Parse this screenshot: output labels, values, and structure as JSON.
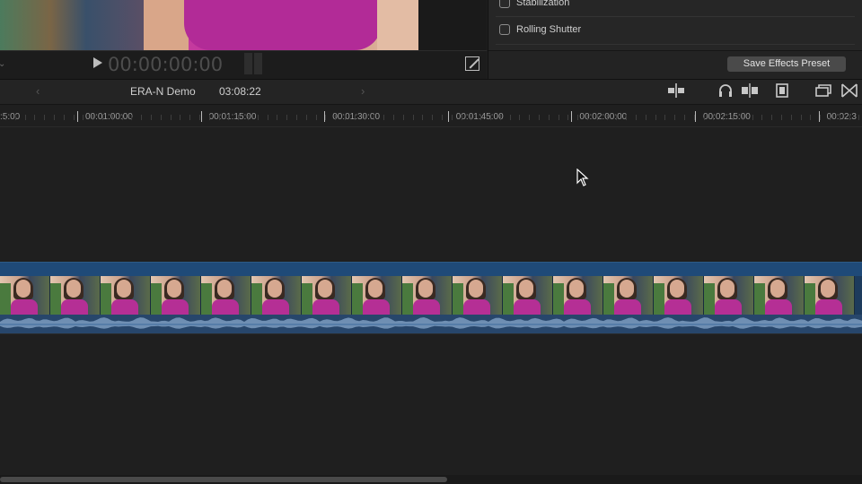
{
  "viewer": {
    "timecode": "00:00:00:00"
  },
  "inspector": {
    "options": [
      {
        "label": "Stabilization",
        "checked": false
      },
      {
        "label": "Rolling Shutter",
        "checked": false
      }
    ],
    "save_button": "Save Effects Preset"
  },
  "timeline": {
    "project_name": "ERA-N Demo",
    "project_duration": "03:08:22",
    "ruler": [
      ":5:00",
      "00:01:00:00",
      "00:01:15:00",
      "00:01:30:00",
      "00:01:45:00",
      "00:02:00:00",
      "00:02:15:00",
      "00:02:3"
    ],
    "clip_frames": 17
  },
  "icons": {
    "play": "play-icon",
    "fullscreen": "fullscreen-icon",
    "header_right": [
      "clip-appearance-icon",
      "audio-skimming-icon",
      "snapping-icon",
      "clip-connections-icon",
      "browser-toggle-icon",
      "transitions-icon"
    ]
  },
  "colors": {
    "clip_blue": "#1f4a78",
    "accent_magenta": "#b22b97"
  }
}
